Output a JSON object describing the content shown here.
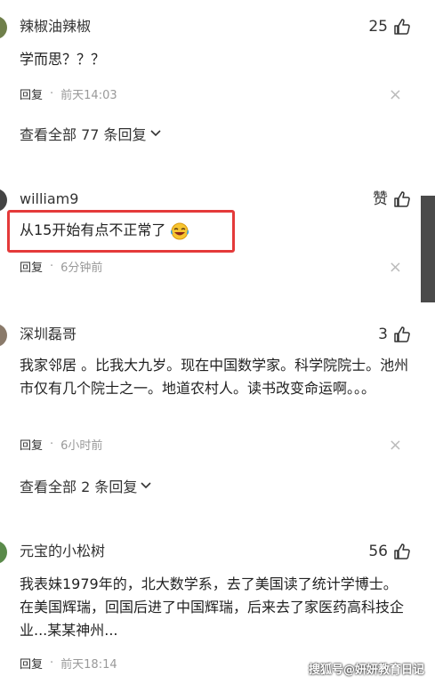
{
  "comments": [
    {
      "username": "辣椒油辣椒",
      "likes": "25",
      "text": "学而思？？？",
      "reply_label": "回复",
      "time": "前天14:03",
      "view_all": "查看全部 77 条回复"
    },
    {
      "username": "william9",
      "likes": "赞",
      "text": "从15开始有点不正常了",
      "reply_label": "回复",
      "time": "6分钟前"
    },
    {
      "username": "深圳磊哥",
      "likes": "3",
      "text": "我家邻居 。比我大九岁。现在中国数学家。科学院院士。池州市仅有几个院士之一。地道农村人。读书改变命运啊。。。",
      "reply_label": "回复",
      "time": "6小时前",
      "view_all": "查看全部 2 条回复"
    },
    {
      "username": "元宝的小松树",
      "likes": "56",
      "text": "我表妹1979年的，北大数学系，去了美国读了统计学博士。在美国辉瑞，回国后进了中国辉瑞，后来去了家医药高科技企业...某某神州...",
      "reply_label": "回复",
      "time": "前天18:14"
    }
  ],
  "meta_separator": "·",
  "close_glyph": "×",
  "watermark": "搜狐号@妍妍教育日记",
  "colors": {
    "highlight_border": "#e43a3a",
    "scrollbar": "#4a4a4a"
  }
}
